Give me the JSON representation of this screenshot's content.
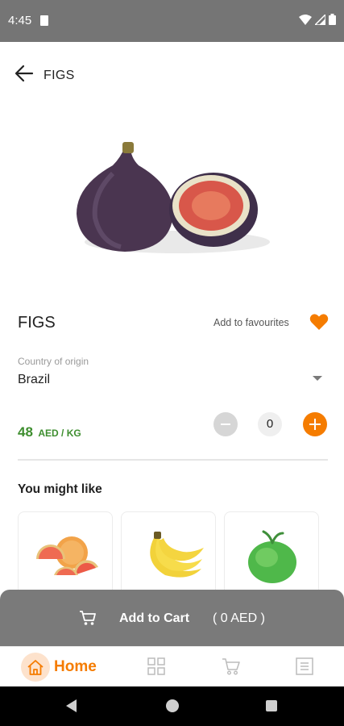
{
  "status_bar": {
    "time": "4:45"
  },
  "header": {
    "title": "FIGS"
  },
  "product": {
    "name": "FIGS",
    "favourite_label": "Add to favourites",
    "origin_label": "Country of origin",
    "origin_value": "Brazil",
    "price": "48",
    "price_unit": "AED / KG",
    "quantity": "0"
  },
  "recommendations": {
    "title": "You might like",
    "items": [
      {
        "icon": "grapefruit-image"
      },
      {
        "icon": "banana-image"
      },
      {
        "icon": "coconut-image"
      }
    ]
  },
  "cart": {
    "label": "Add to Cart",
    "total": "( 0 AED )"
  },
  "bottom_nav": {
    "home_label": "Home",
    "items": [
      "home-icon",
      "grid-icon",
      "cart-icon",
      "list-icon"
    ]
  },
  "colors": {
    "accent": "#f57c00",
    "price": "#3e8e2f",
    "status_bar": "#757575",
    "cart_bar": "#7a7a7a"
  }
}
